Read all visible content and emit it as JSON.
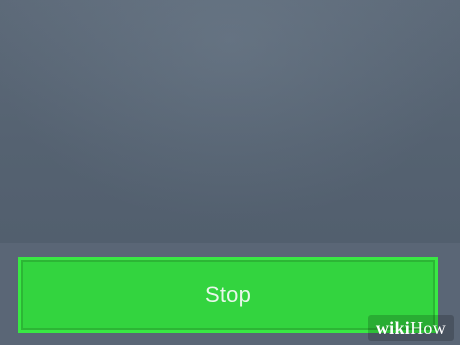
{
  "app": {
    "primary_action": {
      "label": "Stop"
    }
  },
  "watermark": {
    "part1": "wiki",
    "part2": "How"
  },
  "colors": {
    "background": "#586575",
    "button": "#33d43f",
    "button_border": "#39e844",
    "button_text": "#e8f7ea"
  }
}
